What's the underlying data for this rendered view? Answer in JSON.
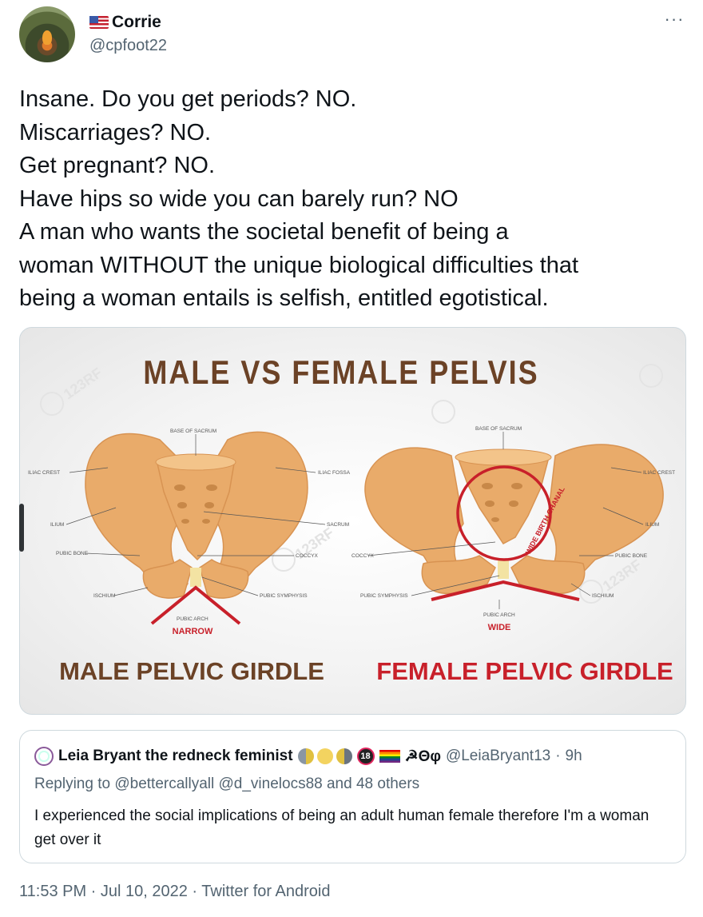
{
  "author": {
    "display_name": "Corrie",
    "handle": "@cpfoot22"
  },
  "more_icon": "···",
  "tweet_lines": [
    "Insane. Do you get periods? NO.",
    "Miscarriages? NO.",
    "Get pregnant? NO.",
    "Have hips so wide you can barely run? NO",
    "A man who wants the societal benefit of being a",
    "woman WITHOUT the unique biological difficulties that",
    "being a woman entails is selfish, entitled egotistical."
  ],
  "image": {
    "title": "MALE VS FEMALE PELVIS",
    "watermark": "123RF",
    "male": {
      "caption": "MALE PELVIC GIRDLE",
      "arch_label": "PUBIC ARCH",
      "arch_value": "NARROW",
      "labels": {
        "base_of_sacrum": "BASE OF SACRUM",
        "iliac_crest": "ILIAC CREST",
        "iliac_fossa": "ILIAC FOSSA",
        "ilium": "ILIUM",
        "sacrum": "SACRUM",
        "pubic_bone": "PUBIC BONE",
        "coccyx": "COCCYX",
        "ischium": "ISCHIUM",
        "pubic_symphysis": "PUBIC SYMPHYSIS"
      }
    },
    "female": {
      "caption": "FEMALE PELVIC GIRDLE",
      "arch_label": "PUBIC ARCH",
      "arch_value": "WIDE",
      "birth_canal": "WIDE BIRTH CHANAL",
      "labels": {
        "base_of_sacrum": "BASE OF SACRUM",
        "iliac_crest": "ILIAC CREST",
        "ilium": "ILIUM",
        "coccyx": "COCCYX",
        "pubic_bone": "PUBIC BONE",
        "pubic_symphysis": "PUBIC SYMPHYSIS",
        "ischium": "ISCHIUM"
      }
    }
  },
  "quote": {
    "display_name": "Leia Bryant the redneck feminist",
    "badge_eighteen": "18",
    "extra_symbols": "☭Θφ",
    "handle": "@LeiaBryant13",
    "separator": "·",
    "time": "9h",
    "reply_context": "Replying to @bettercallyall @d_vinelocs88 and 48 others",
    "body": "I experienced the social implications of being an adult human female therefore I'm a woman get over it"
  },
  "meta": "11:53 PM · Jul 10, 2022 · Twitter for Android",
  "colors": {
    "text": "#0f1419",
    "secondary": "#536471",
    "bone": "#e9ab6a",
    "title_brown": "#6b4226",
    "female_red": "#c8202a"
  }
}
